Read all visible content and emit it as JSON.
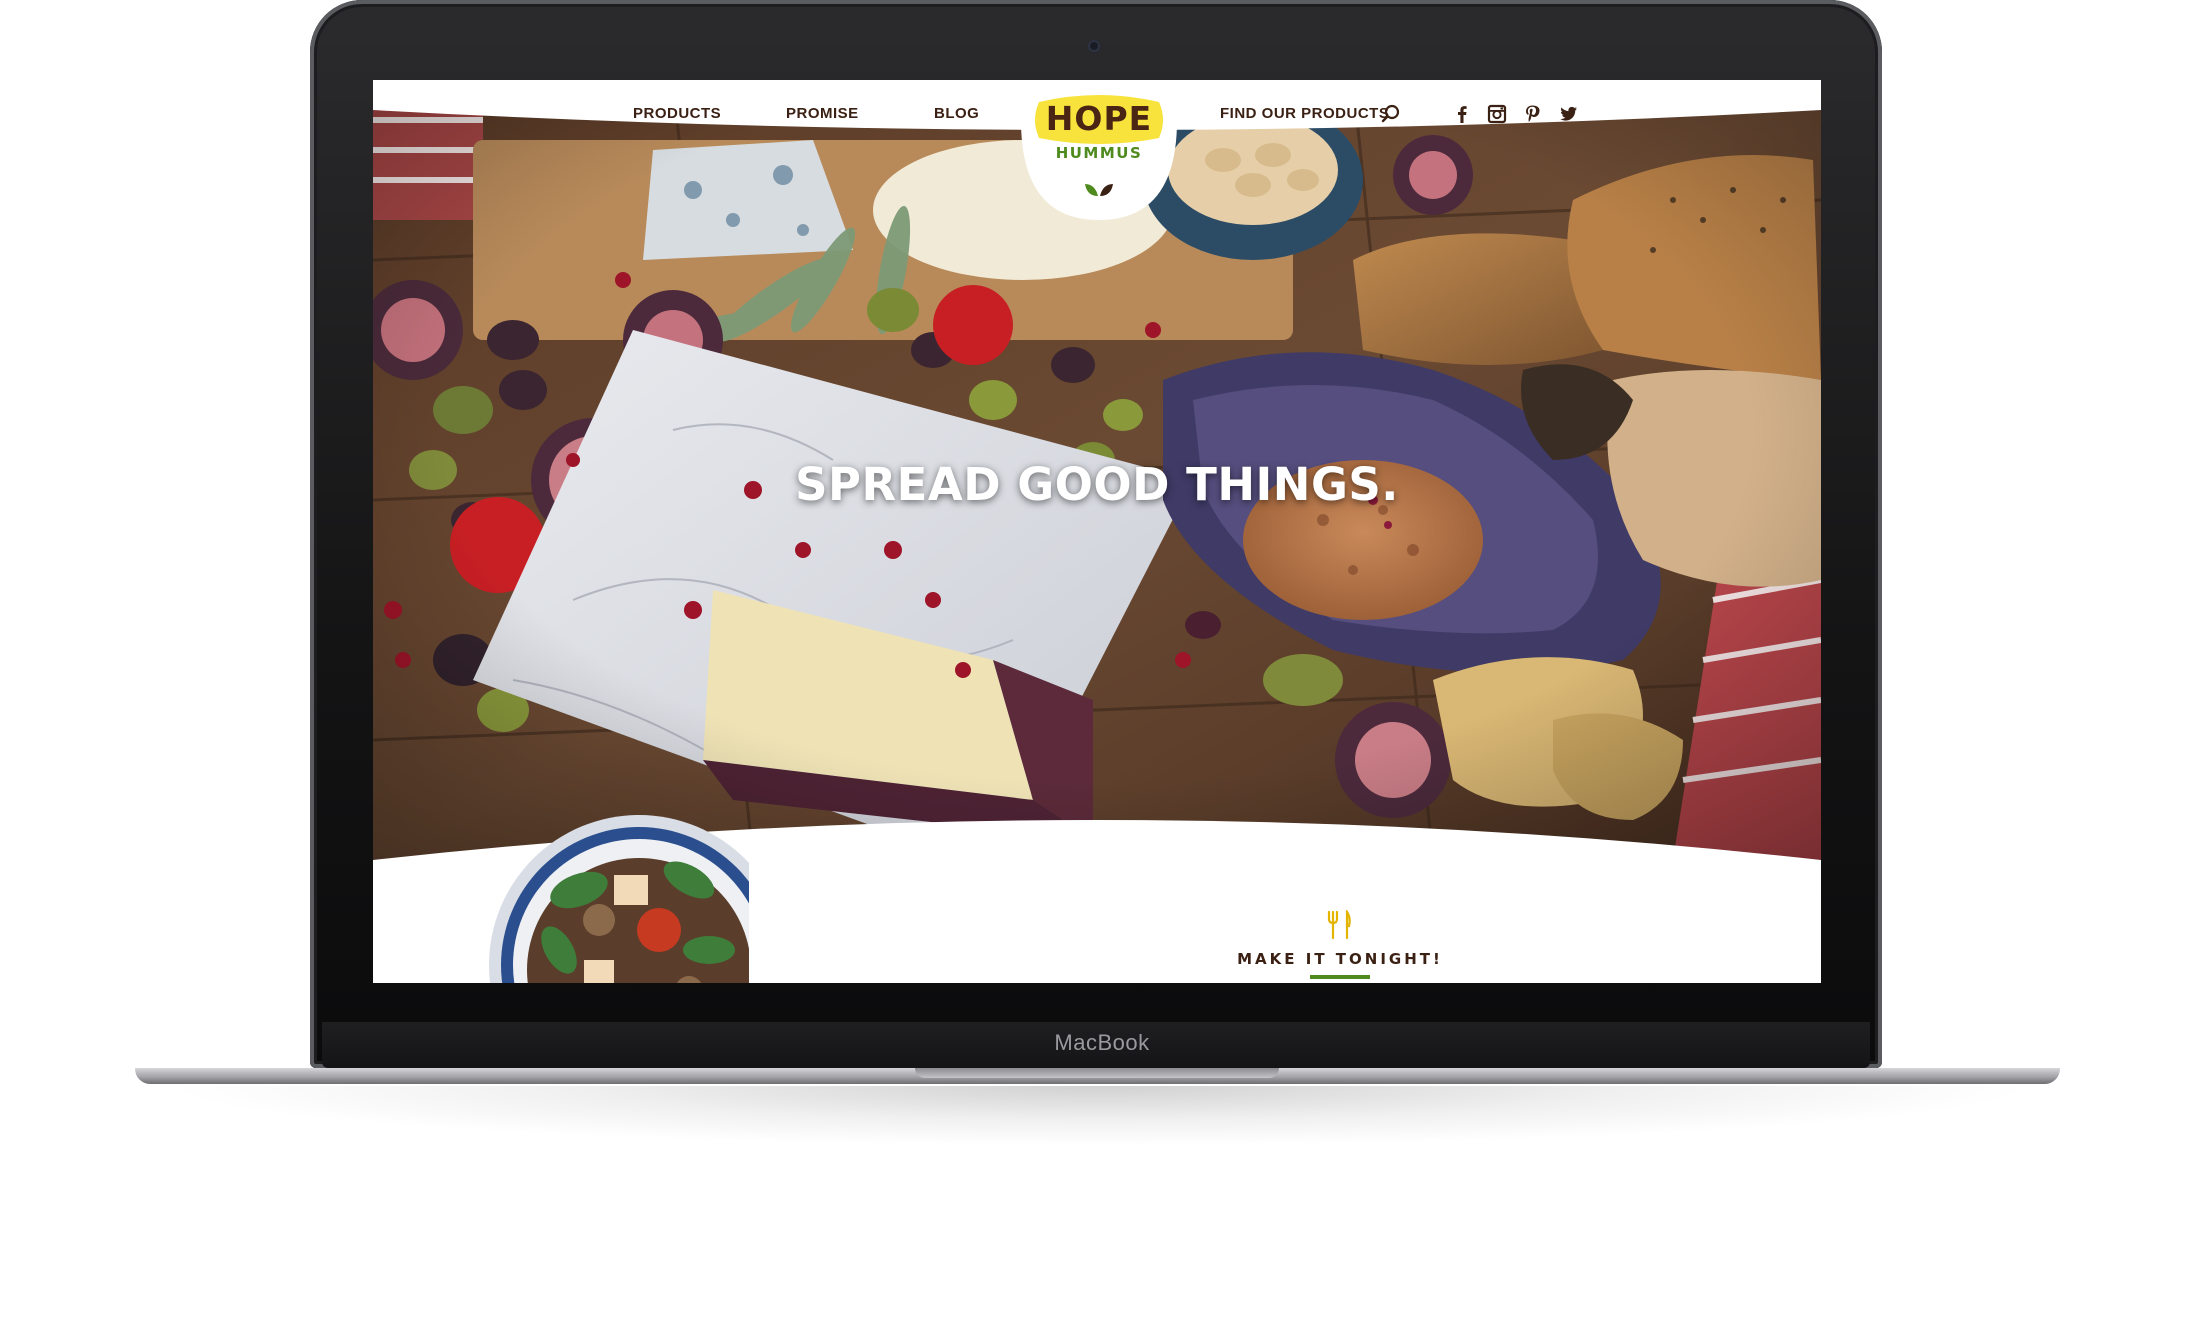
{
  "device": {
    "brand_label": "MacBook"
  },
  "nav": {
    "products": "PRODUCTS",
    "promise": "PROMISE",
    "blog": "BLOG",
    "find": "FIND OUR PRODUCTS",
    "icons": [
      "search-icon",
      "facebook-icon",
      "instagram-icon",
      "pinterest-icon",
      "twitter-icon"
    ]
  },
  "logo": {
    "hope": "HOPE",
    "hummus": "HUMMUS"
  },
  "hero": {
    "headline": "SPREAD GOOD THINGS."
  },
  "feature": {
    "cta": "MAKE IT TONIGHT!"
  },
  "colors": {
    "brand_brown": "#3b2114",
    "brand_green": "#4f8a1e",
    "logo_yellow": "#f7e33b"
  }
}
